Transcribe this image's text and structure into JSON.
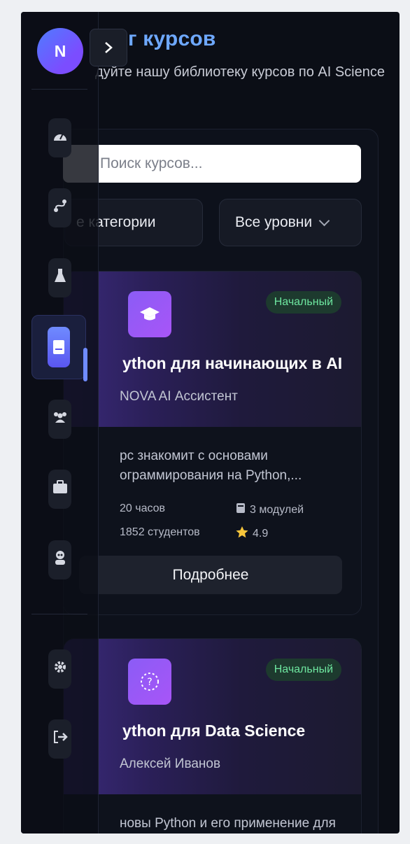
{
  "header": {
    "title": "г курсов",
    "subtitle": "дуйте нашу библиотеку курсов по AI Science"
  },
  "search": {
    "placeholder": "Поиск курсов..."
  },
  "filters": {
    "category": "е категории",
    "level": "Все уровни"
  },
  "user": {
    "avatar_initial": "N"
  },
  "sidebar": {
    "items": [
      {
        "icon": "gauge-icon"
      },
      {
        "icon": "route-icon"
      },
      {
        "icon": "flask-icon"
      },
      {
        "icon": "book-icon"
      },
      {
        "icon": "users-icon"
      },
      {
        "icon": "briefcase-icon"
      },
      {
        "icon": "robot-icon"
      },
      {
        "icon": "gear-icon"
      },
      {
        "icon": "logout-icon"
      }
    ]
  },
  "courses": [
    {
      "level": "Начальный",
      "title": "ython для начинающих в AI",
      "author": "NOVA AI Ассистент",
      "description": "рс знакомит с основами ограммирования на Python,...",
      "hours": "20 часов",
      "modules": "3 модулей",
      "students": "1852 студентов",
      "rating": "4.9",
      "button": "Подробнее"
    },
    {
      "level": "Начальный",
      "title": "ython для Data Science",
      "author": "Алексей Иванов",
      "description": "новы Python и его применение для"
    }
  ],
  "colors": {
    "accent": "#6ea8fe",
    "badge_text": "#6ee7a0",
    "card_gradient": "#3a2a7a"
  }
}
